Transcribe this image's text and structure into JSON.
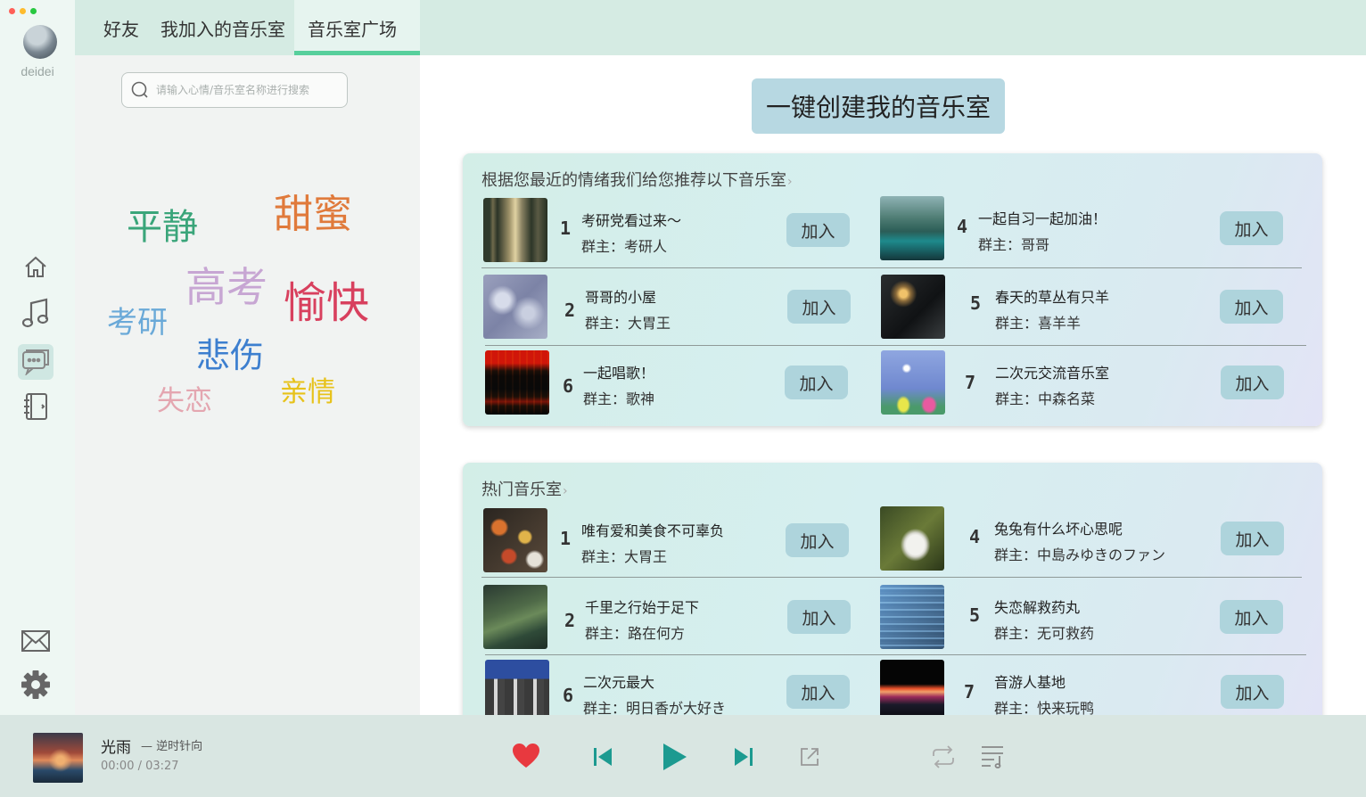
{
  "window": {
    "traffic_lights": [
      "#ff5f57",
      "#febc2e",
      "#28c840"
    ]
  },
  "user": {
    "name": "deidei"
  },
  "nav": {
    "items": [
      {
        "id": "home",
        "icon": "home-icon"
      },
      {
        "id": "music",
        "icon": "music-note-icon"
      },
      {
        "id": "chat",
        "icon": "chat-icon",
        "active": true
      },
      {
        "id": "notebook",
        "icon": "notebook-icon"
      },
      {
        "id": "mail",
        "icon": "mail-icon"
      },
      {
        "id": "settings",
        "icon": "gear-icon"
      }
    ]
  },
  "tabs": [
    {
      "label": "好友"
    },
    {
      "label": "我加入的音乐室"
    },
    {
      "label": "音乐室广场",
      "active": true
    }
  ],
  "search": {
    "placeholder": "请输入心情/音乐室名称进行搜索"
  },
  "moods": [
    {
      "label": "平静",
      "color": "#3aa57a"
    },
    {
      "label": "甜蜜",
      "color": "#e07a3b"
    },
    {
      "label": "高考",
      "color": "#c7a6d3"
    },
    {
      "label": "愉快",
      "color": "#d8405e"
    },
    {
      "label": "考研",
      "color": "#6aa9d8"
    },
    {
      "label": "悲伤",
      "color": "#3d7fcf"
    },
    {
      "label": "失恋",
      "color": "#e4a6b0"
    },
    {
      "label": "亲情",
      "color": "#e7c21a"
    }
  ],
  "create_button": "一键创建我的音乐室",
  "join_label": "加入",
  "recommended": {
    "title": "根据您最近的情绪我们给您推荐以下音乐室",
    "rooms": [
      {
        "rank": "1",
        "name": "考研党看过来～",
        "owner": "群主：考研人",
        "thumb": "forest"
      },
      {
        "rank": "4",
        "name": "一起自习一起加油！",
        "owner": "群主：哥哥",
        "thumb": "lake"
      },
      {
        "rank": "2",
        "name": "哥哥的小屋",
        "owner": "群主：大胃王",
        "thumb": "frost"
      },
      {
        "rank": "5",
        "name": "春天的草丛有只羊",
        "owner": "群主：喜羊羊",
        "thumb": "lantern"
      },
      {
        "rank": "6",
        "name": "一起唱歌！",
        "owner": "群主：歌神",
        "thumb": "mixer"
      },
      {
        "rank": "7",
        "name": "二次元交流音乐室",
        "owner": "群主：中森名菜",
        "thumb": "sheep"
      }
    ]
  },
  "hot": {
    "title": "热门音乐室",
    "rooms": [
      {
        "rank": "1",
        "name": "唯有爱和美食不可辜负",
        "owner": "群主：大胃王",
        "thumb": "food"
      },
      {
        "rank": "4",
        "name": "兔兔有什么坏心思呢",
        "owner": "群主：中島みゆきのファン",
        "thumb": "rabbit"
      },
      {
        "rank": "2",
        "name": "千里之行始于足下",
        "owner": "群主：路在何方",
        "thumb": "road"
      },
      {
        "rank": "5",
        "name": "失恋解救药丸",
        "owner": "群主：无可救药",
        "thumb": "glitch"
      },
      {
        "rank": "6",
        "name": "二次元最大",
        "owner": "群主：明日香が大好き",
        "thumb": "building"
      },
      {
        "rank": "7",
        "name": "音游人基地",
        "owner": "群主：快来玩鸭",
        "thumb": "neon"
      }
    ]
  },
  "player": {
    "title": "光雨",
    "artist": "— 逆时针向",
    "time": "00:00 / 03:27",
    "like_color": "#e8393f",
    "accent": "#1c9a90"
  }
}
